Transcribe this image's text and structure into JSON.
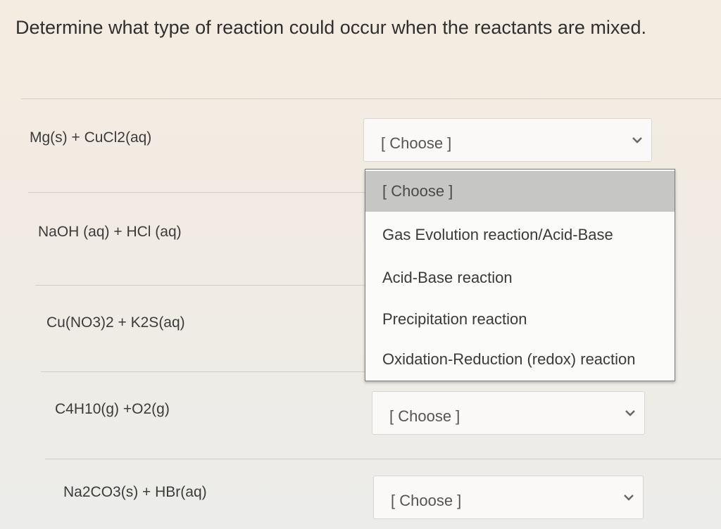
{
  "question": {
    "title": "Determine what type of reaction could occur when the reactants are mixed."
  },
  "rows": [
    {
      "reactants": "Mg(s) + CuCl2(aq)",
      "selected": "[ Choose ]"
    },
    {
      "reactants": "NaOH (aq) + HCl (aq)"
    },
    {
      "reactants": "Cu(NO3)2 + K2S(aq)"
    },
    {
      "reactants": "C4H10(g) +O2(g)",
      "selected": "[ Choose ]"
    },
    {
      "reactants": "Na2CO3(s) + HBr(aq)",
      "selected": "[ Choose ]"
    }
  ],
  "dropdown": {
    "options": [
      "[ Choose ]",
      "Gas Evolution reaction/Acid-Base",
      "Acid-Base reaction",
      "Precipitation reaction",
      "Oxidation-Reduction (redox) reaction"
    ],
    "highlighted_index": 0
  },
  "icons": {
    "select_arrow": "chevron-down-icon"
  },
  "colors": {
    "highlight": "#c6c6c4",
    "text": "#333333"
  }
}
